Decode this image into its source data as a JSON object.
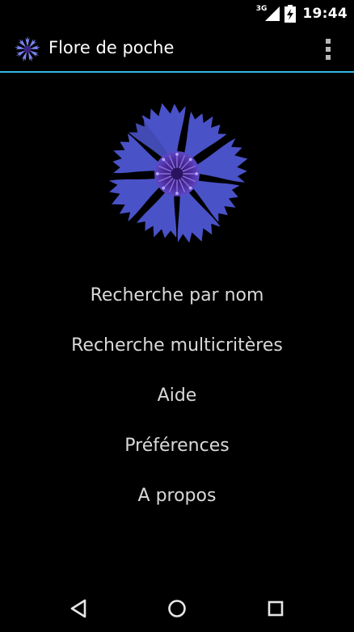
{
  "status_bar": {
    "network_type": "3G",
    "time": "19:44",
    "icons": [
      "signal-icon",
      "battery-charging-icon"
    ]
  },
  "action_bar": {
    "title": "Flore de poche",
    "icon": "cornflower-app-icon",
    "overflow_icon": "overflow-menu-icon",
    "divider_color": "#33b5e5"
  },
  "hero_image": "cornflower-image",
  "menu": {
    "items": [
      {
        "label": "Recherche par nom"
      },
      {
        "label": "Recherche multicritères"
      },
      {
        "label": "Aide"
      },
      {
        "label": "Préférences"
      },
      {
        "label": "A propos"
      }
    ]
  },
  "nav_bar": {
    "buttons": [
      "back-icon",
      "home-icon",
      "recents-icon"
    ]
  },
  "colors": {
    "background": "#000000",
    "accent": "#33b5e5",
    "flower_petal": "#6f7af0",
    "flower_center": "#4a2a8a"
  }
}
